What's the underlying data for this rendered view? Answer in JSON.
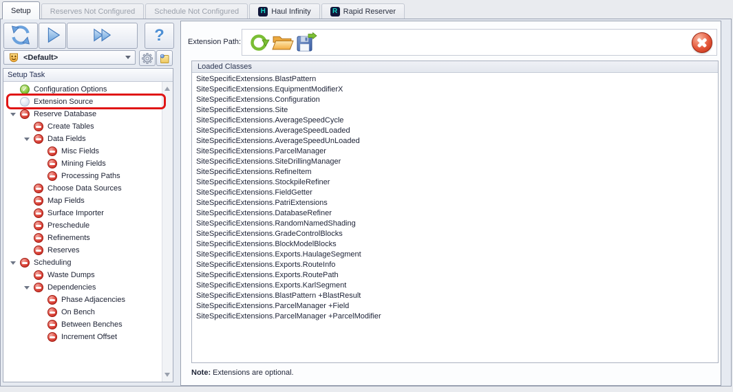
{
  "tabs": [
    {
      "name": "tab-setup",
      "label": "Setup",
      "state": "active"
    },
    {
      "name": "tab-reserves",
      "label": "Reserves Not Configured",
      "state": "disabled"
    },
    {
      "name": "tab-schedule",
      "label": "Schedule Not Configured",
      "state": "disabled"
    },
    {
      "name": "tab-haul-infinity",
      "label": "Haul Infinity",
      "state": "normal",
      "icon_letter": "H"
    },
    {
      "name": "tab-rapid-reserver",
      "label": "Rapid Reserver",
      "state": "normal",
      "icon_letter": "R"
    }
  ],
  "toolbar": {
    "scenario_value": "<Default>"
  },
  "setup_tree": {
    "header": "Setup Task",
    "items": [
      {
        "label": "Configuration Options",
        "icon": "check",
        "level": 0
      },
      {
        "label": "Extension Source",
        "icon": "pending",
        "level": 0,
        "annotated": true
      },
      {
        "label": "Reserve Database",
        "icon": "blocked",
        "level": 0,
        "expander": true
      },
      {
        "label": "Create Tables",
        "icon": "blocked",
        "level": 1
      },
      {
        "label": "Data Fields",
        "icon": "blocked",
        "level": 1,
        "expander": true
      },
      {
        "label": "Misc Fields",
        "icon": "blocked",
        "level": 2
      },
      {
        "label": "Mining Fields",
        "icon": "blocked",
        "level": 2
      },
      {
        "label": "Processing Paths",
        "icon": "blocked",
        "level": 2
      },
      {
        "label": "Choose Data Sources",
        "icon": "blocked",
        "level": 1
      },
      {
        "label": "Map Fields",
        "icon": "blocked",
        "level": 1
      },
      {
        "label": "Surface Importer",
        "icon": "blocked",
        "level": 1
      },
      {
        "label": "Preschedule",
        "icon": "blocked",
        "level": 1
      },
      {
        "label": "Refinements",
        "icon": "blocked",
        "level": 1
      },
      {
        "label": "Reserves",
        "icon": "blocked",
        "level": 1
      },
      {
        "label": "Scheduling",
        "icon": "blocked",
        "level": 0,
        "expander": true
      },
      {
        "label": "Waste Dumps",
        "icon": "blocked",
        "level": 1
      },
      {
        "label": "Dependencies",
        "icon": "blocked",
        "level": 1,
        "expander": true
      },
      {
        "label": "Phase Adjacencies",
        "icon": "blocked",
        "level": 2
      },
      {
        "label": "On Bench",
        "icon": "blocked",
        "level": 2
      },
      {
        "label": "Between Benches",
        "icon": "blocked",
        "level": 2
      },
      {
        "label": "Increment Offset",
        "icon": "blocked",
        "level": 2
      }
    ]
  },
  "extension_panel": {
    "path_label": "Extension Path:",
    "loaded_classes_header": "Loaded Classes",
    "classes": [
      "SiteSpecificExtensions.BlastPattern",
      "SiteSpecificExtensions.EquipmentModifierX",
      "SiteSpecificExtensions.Configuration",
      "SiteSpecificExtensions.Site",
      "SiteSpecificExtensions.AverageSpeedCycle",
      "SiteSpecificExtensions.AverageSpeedLoaded",
      "SiteSpecificExtensions.AverageSpeedUnLoaded",
      "SiteSpecificExtensions.ParcelManager",
      "SiteSpecificExtensions.SiteDrillingManager",
      "SiteSpecificExtensions.RefineItem",
      "SiteSpecificExtensions.StockpileRefiner",
      "SiteSpecificExtensions.FieldGetter",
      "SiteSpecificExtensions.PatriExtensions",
      "SiteSpecificExtensions.DatabaseRefiner",
      "SiteSpecificExtensions.RandomNamedShading",
      "SiteSpecificExtensions.GradeControlBlocks",
      "SiteSpecificExtensions.BlockModelBlocks",
      "SiteSpecificExtensions.Exports.HaulageSegment",
      "SiteSpecificExtensions.Exports.RouteInfo",
      "SiteSpecificExtensions.Exports.RoutePath",
      "SiteSpecificExtensions.Exports.KarlSegment",
      "SiteSpecificExtensions.BlastPattern +BlastResult",
      "SiteSpecificExtensions.ParcelManager +Field",
      "SiteSpecificExtensions.ParcelManager +ParcelModifier"
    ],
    "note_label": "Note:",
    "note_text": " Extensions are optional."
  },
  "colors": {
    "annotation_red": "#e01515",
    "status_done_green": "#8cc83e",
    "status_blocked_red": "#dd4a40",
    "status_pending_gray": "#dde7f2",
    "tab_icon_navy": "#10163a",
    "tab_icon_teal": "#17d6c6",
    "close_button_red": "#e4573a",
    "accent_blue": "#4e8fd4"
  }
}
